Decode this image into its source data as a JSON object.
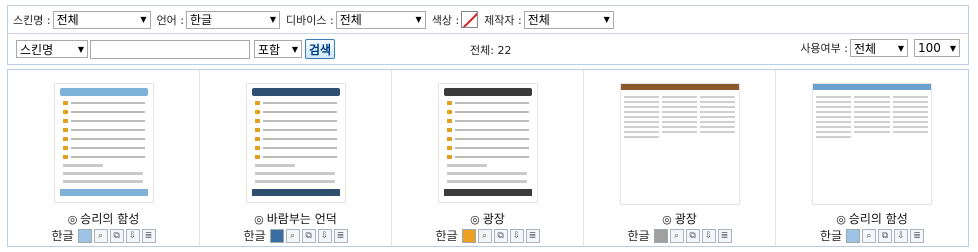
{
  "filters": {
    "skin_name_label": "스킨명 :",
    "skin_name_value": "전체",
    "language_label": "언어 :",
    "language_value": "한글",
    "device_label": "디바이스 :",
    "device_value": "전체",
    "color_label": "색상 :",
    "author_label": "제작자 :",
    "author_value": "전체"
  },
  "search": {
    "field_value": "스킨명",
    "input_value": "",
    "mode_value": "포함",
    "button_label": "검색",
    "total_text": "전체: 22",
    "usage_label": "사용여부 :",
    "usage_value": "전체",
    "page_size_value": "100"
  },
  "skins": [
    {
      "name": "승리의 함성",
      "lang": "한글",
      "color": "#9dc3e6",
      "thumb": "mobile",
      "head": "#7fb2d9"
    },
    {
      "name": "바람부는 언덕",
      "lang": "한글",
      "color": "#3a6ea5",
      "thumb": "mobile",
      "head": "#2f4f70"
    },
    {
      "name": "광장",
      "lang": "한글",
      "color": "#f0a020",
      "thumb": "mobile",
      "head": "#3a3a3a"
    },
    {
      "name": "광장",
      "lang": "한글",
      "color": "#a0a0a0",
      "thumb": "desktop",
      "head": "#8a5a2a"
    },
    {
      "name": "승리의 함성",
      "lang": "한글",
      "color": "#9dc3e6",
      "thumb": "desktop",
      "head": "#6aa0d0"
    }
  ],
  "icons": {
    "radio": "radio-icon",
    "preview": "magnifier-icon",
    "copy": "copy-icon",
    "download": "download-icon",
    "doc": "document-icon"
  }
}
